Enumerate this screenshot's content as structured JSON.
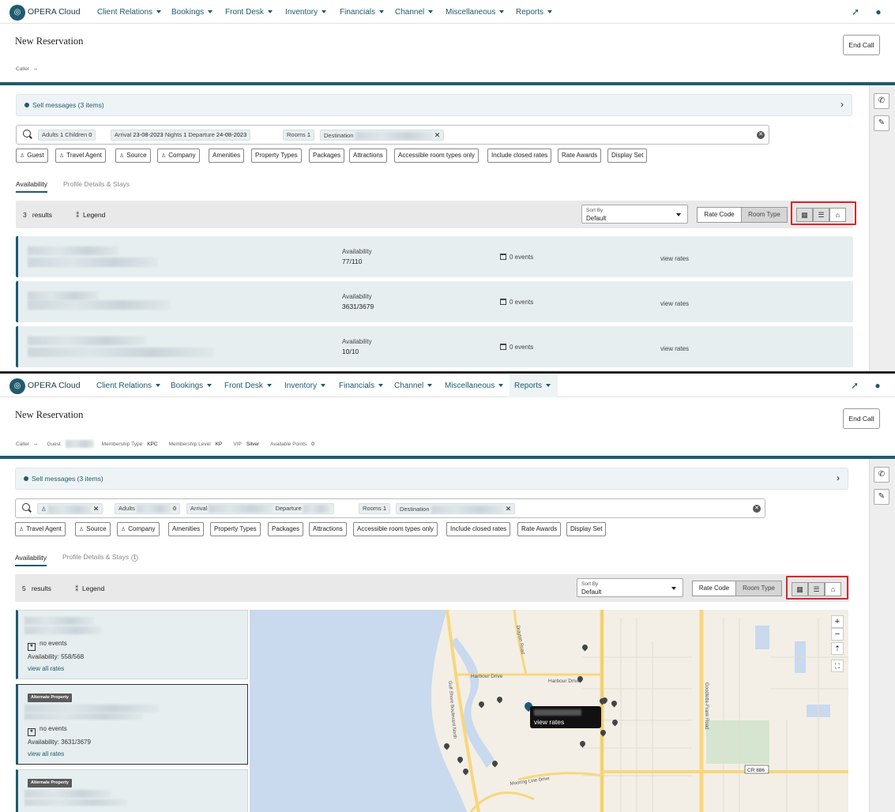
{
  "brand": "OPERA Cloud",
  "nav": [
    "Client Relations",
    "Bookings",
    "Front Desk",
    "Inventory",
    "Financials",
    "Channel",
    "Miscellaneous",
    "Reports"
  ],
  "page_title": "New Reservation",
  "end_call": "End Call",
  "caller_label": "Caller",
  "caller_value": "--",
  "guest_label": "Guest",
  "membership_type_label": "Membership Type",
  "membership_type": "KPC",
  "membership_level_label": "Membership Level",
  "membership_level": "KP",
  "vip_label": "VIP",
  "vip": "Silver",
  "points_label": "Available Points",
  "points": "0",
  "sell_messages": "Sell messages (3 items)",
  "p1_search": {
    "adults_label": "Adults",
    "adults": "1",
    "children_label": "Children",
    "children": "0",
    "arrival_label": "Arrival",
    "arrival": "23-08-2023",
    "nights_label": "Nights",
    "nights": "1",
    "departure_label": "Departure",
    "departure": "24-08-2023",
    "rooms_label": "Rooms",
    "rooms": "1",
    "destination_label": "Destination"
  },
  "p1_filters": [
    "Guest",
    "Travel Agent",
    "Source",
    "Company",
    "Amenities",
    "Property Types",
    "Packages",
    "Attractions",
    "Accessible room types only",
    "Include closed rates",
    "Rate Awards",
    "Display Set"
  ],
  "p2_search": {
    "adults_label": "Adults",
    "adults": "0",
    "arrival_label": "Arrival",
    "departure_label": "Departure",
    "rooms_label": "Rooms",
    "rooms": "1",
    "destination_label": "Destination"
  },
  "p2_filters": [
    "Travel Agent",
    "Source",
    "Company",
    "Amenities",
    "Property Types",
    "Packages",
    "Attractions",
    "Accessible room types only",
    "Include closed rates",
    "Rate Awards",
    "Display Set"
  ],
  "tabs": {
    "availability": "Availability",
    "profile": "Profile Details & Stays",
    "profile_badge": "1"
  },
  "p1_results": {
    "count": "3",
    "label": "results"
  },
  "p2_results": {
    "count": "5",
    "label": "results"
  },
  "legend": "Legend",
  "sort_by_label": "Sort By",
  "sort_by_value": "Default",
  "rate_code": "Rate Code",
  "room_type": "Room Type",
  "availability_label": "Availability",
  "p1_cards": [
    {
      "availability": "77/110",
      "events": "0 events",
      "view_rates": "view rates"
    },
    {
      "availability": "3631/3679",
      "events": "0 events",
      "view_rates": "view rates"
    },
    {
      "availability": "10/10",
      "events": "0 events",
      "view_rates": "view rates"
    }
  ],
  "p2_cards": [
    {
      "badge": "",
      "events": "no events",
      "availability": "Availability: 558/568",
      "link": "view all rates"
    },
    {
      "badge": "Alternate Property",
      "events": "no events",
      "availability": "Availability: 3631/3679",
      "link": "view all rates"
    },
    {
      "badge": "Alternate Property"
    }
  ],
  "map": {
    "roads": [
      "Harbour Drive",
      "Harbour Drive",
      "Drayton Road",
      "Gulf Shore Boulevard North",
      "Goodlette-Frank Road",
      "Mooring Line Drive",
      "CR 886"
    ],
    "tooltip": "view rates",
    "zoom_in": "+",
    "zoom_out": "−"
  }
}
